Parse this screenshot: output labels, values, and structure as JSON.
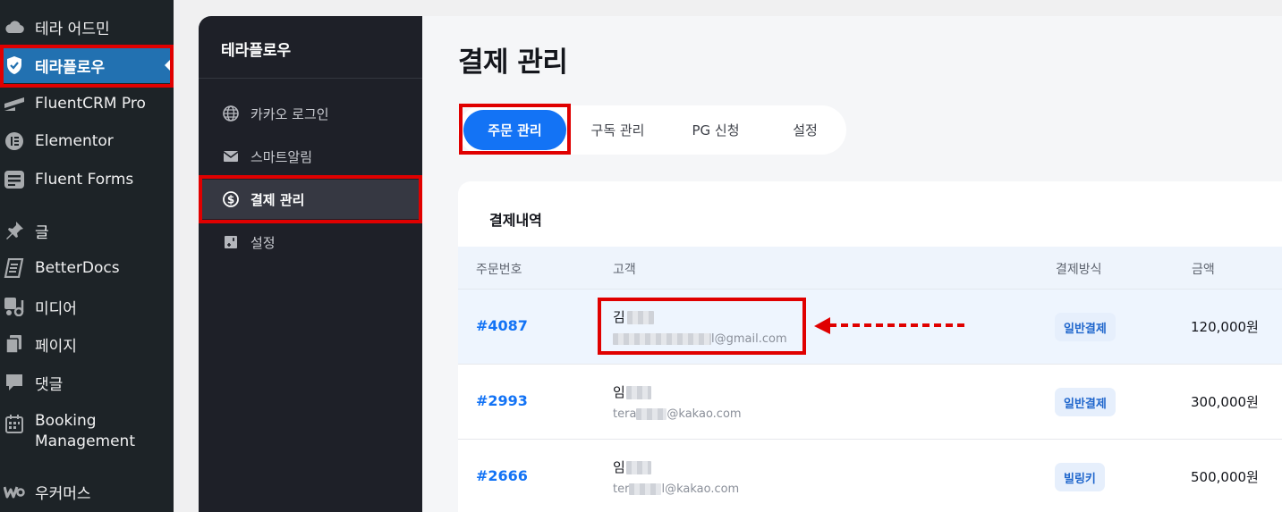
{
  "wp_sidebar": {
    "items": [
      {
        "label": "테라 어드민",
        "icon": "cloud-icon"
      },
      {
        "label": "테라플로우",
        "icon": "shield-icon",
        "active": true
      },
      {
        "label": "FluentCRM Pro",
        "icon": "fluentcrm-icon"
      },
      {
        "label": "Elementor",
        "icon": "elementor-icon"
      },
      {
        "label": "Fluent Forms",
        "icon": "fluent-forms-icon"
      },
      {
        "label": "글",
        "icon": "pin-icon"
      },
      {
        "label": "BetterDocs",
        "icon": "betterdocs-icon"
      },
      {
        "label": "미디어",
        "icon": "media-icon"
      },
      {
        "label": "페이지",
        "icon": "pages-icon"
      },
      {
        "label": "댓글",
        "icon": "comment-icon"
      },
      {
        "label_line1": "Booking",
        "label_line2": "Management",
        "icon": "calendar-icon"
      },
      {
        "label": "우커머스",
        "icon": "woocommerce-icon"
      }
    ]
  },
  "plugin_sidebar": {
    "title": "테라플로우",
    "items": [
      {
        "label": "카카오 로그인",
        "icon": "globe-icon"
      },
      {
        "label": "스마트알림",
        "icon": "mail-icon"
      },
      {
        "label": "결제 관리",
        "icon": "dollar-icon",
        "active": true
      },
      {
        "label": "설정",
        "icon": "settings-icon"
      }
    ]
  },
  "main": {
    "title": "결제 관리",
    "tabs": [
      {
        "label": "주문 관리",
        "active": true
      },
      {
        "label": "구독 관리"
      },
      {
        "label": "PG 신청"
      },
      {
        "label": "설정"
      }
    ],
    "card_title": "결제내역",
    "columns": [
      "주문번호",
      "고객",
      "결제방식",
      "금액"
    ],
    "rows": [
      {
        "order": "#4087",
        "name": "김",
        "email_suffix": "l@gmail.com",
        "payment": "일반결제",
        "amount": "120,000원"
      },
      {
        "order": "#2993",
        "name": "임",
        "email_prefix": "tera",
        "email_suffix": "@kakao.com",
        "payment": "일반결제",
        "amount": "300,000원"
      },
      {
        "order": "#2666",
        "name": "임",
        "email_prefix": "ter",
        "email_suffix": "l@kakao.com",
        "payment": "빌링키",
        "amount": "500,000원"
      }
    ]
  },
  "colors": {
    "wp_sidebar_bg": "#1d2327",
    "wp_active": "#2271b1",
    "plugin_sidebar_bg": "#1e2028",
    "accent_blue": "#1373f5",
    "highlight_red": "#e00000"
  }
}
